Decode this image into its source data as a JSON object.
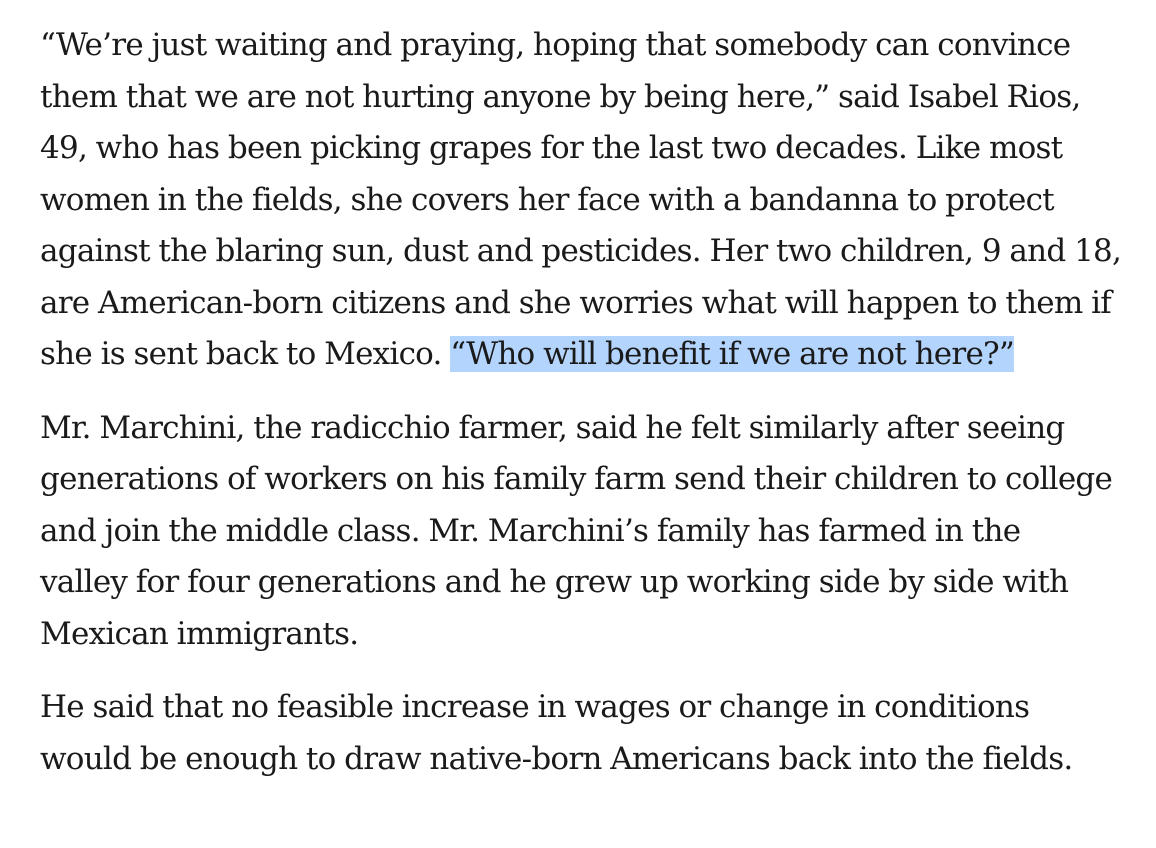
{
  "article": {
    "paragraphs": [
      {
        "lines": [
          "“We’re just waiting and praying, hoping that somebody can convince",
          "them that we are not hurting anyone by being here,” said Isabel Rios,",
          "49, who has been picking grapes for the last two decades. Like most",
          "women in the fields, she covers her face with a bandanna to protect",
          "against the blaring sun, dust and pesticides. Her two children, 9 and 18,",
          "are American-born citizens and she worries what will happen to them if"
        ],
        "last_line_plain": "she is sent back to Mexico. ",
        "last_line_selected": "“Who will benefit if we are not here?”"
      },
      {
        "lines": [
          "Mr. Marchini, the radicchio farmer, said he felt similarly after seeing",
          "generations of workers on his family farm send their children to college",
          "and join the middle class. Mr. Marchini’s family has farmed in the",
          "valley for four generations and he grew up working side by side with",
          "Mexican immigrants."
        ]
      },
      {
        "lines": [
          "He said that no feasible increase in wages or change in conditions",
          "would be enough to draw native-born Americans back into the fields."
        ]
      }
    ],
    "selection_color": "#b3d4fd",
    "text_color": "#1a1a1a"
  }
}
